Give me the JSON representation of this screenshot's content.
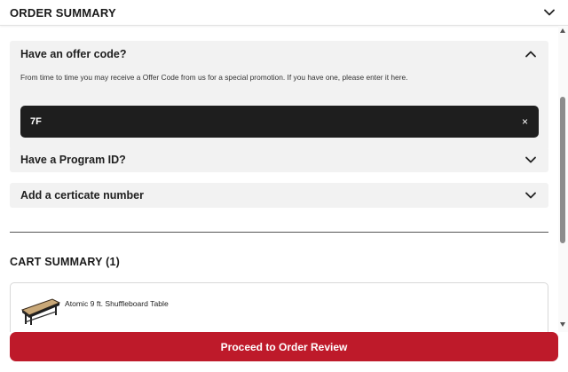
{
  "header": {
    "title": "ORDER SUMMARY",
    "toggle_icon": "chevron-down-icon"
  },
  "offer_code": {
    "title": "Have an offer code?",
    "description": "From time to time you may receive a Offer Code from us for a special promotion. If you have one, please enter it here.",
    "value": "7F",
    "clear_label": "×",
    "toggle_icon": "chevron-up-icon"
  },
  "program_id": {
    "title": "Have a Program ID?",
    "toggle_icon": "chevron-down-icon"
  },
  "certificate": {
    "title": "Add a certicate number",
    "toggle_icon": "chevron-down-icon"
  },
  "cart": {
    "title": "CART SUMMARY (1)",
    "items": [
      {
        "name": "Atomic 9 ft. Shuffleboard Table",
        "image_icon": "shuffleboard-table-image"
      }
    ]
  },
  "actions": {
    "proceed_label": "Proceed to Order Review"
  },
  "colors": {
    "accent": "#be1a2a",
    "input_bg": "#1e1e1e",
    "panel_bg": "#f2f2f2"
  }
}
